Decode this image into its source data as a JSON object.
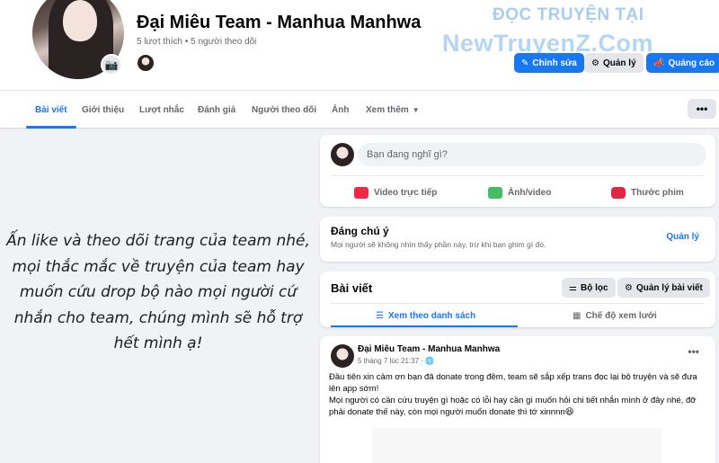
{
  "header": {
    "page_name": "Đại Miêu Team - Manhua Manhwa",
    "meta": "5 lượt thích • 5 người theo dõi",
    "camera_icon": "camera-icon",
    "watermark_line1": "ĐỌC TRUYỆN TẠI",
    "watermark_line2": "NewTruyenZ.Com",
    "buttons": {
      "edit": "Chỉnh sửa",
      "manage": "Quản lý",
      "advertise": "Quảng cáo"
    }
  },
  "tabs": [
    "Bài viết",
    "Giới thiệu",
    "Lượt nhắc",
    "Đánh giá",
    "Người theo dõi",
    "Ảnh",
    "Xem thêm"
  ],
  "more_button": "•••",
  "left_panel": {
    "text": "Ấn like và theo dõi trang của team nhé, mọi thắc mắc về truyện của team hay muốn cứu drop bộ nào mọi người cứ nhắn cho team, chúng mình sẽ hỗ trợ hết mình ạ!"
  },
  "composer": {
    "placeholder": "Bạn đang nghĩ gì?",
    "actions": {
      "live": "Video trực tiếp",
      "photo": "Ảnh/video",
      "reel": "Thước phim"
    }
  },
  "notice": {
    "title": "Đáng chú ý",
    "desc": "Mọi người sẽ không nhìn thấy phần này, trừ khi bạn ghim gì đó.",
    "manage": "Quản lý"
  },
  "posts_header": {
    "title": "Bài viết",
    "filter": "Bộ lọc",
    "manage_posts": "Quản lý bài viết",
    "list_view": "Xem theo danh sách",
    "grid_view": "Chế độ xem lưới"
  },
  "post": {
    "author": "Đại Miêu Team - Manhua Manhwa",
    "time": "5 tháng 7 lúc 21:37 · ",
    "more": "•••",
    "text_1": "Đầu tiên xin cảm ơn bạn đã donate trong đêm, team sẽ sắp xếp trans đọc lại bộ truyện và sẽ đưa lên app sớm!",
    "text_2": "Mọi người có cần cứu truyện gì hoặc có lỗi hay cần gì muốn hỏi chi tiết nhắn mình ở đây nhé, đỡ phải donate thế này, còn mọi người muốn donate thì tớ xinnnn😆"
  },
  "colors": {
    "accent": "#1877f2",
    "background": "#f0f2f5",
    "watermark": "#a9cff2"
  }
}
